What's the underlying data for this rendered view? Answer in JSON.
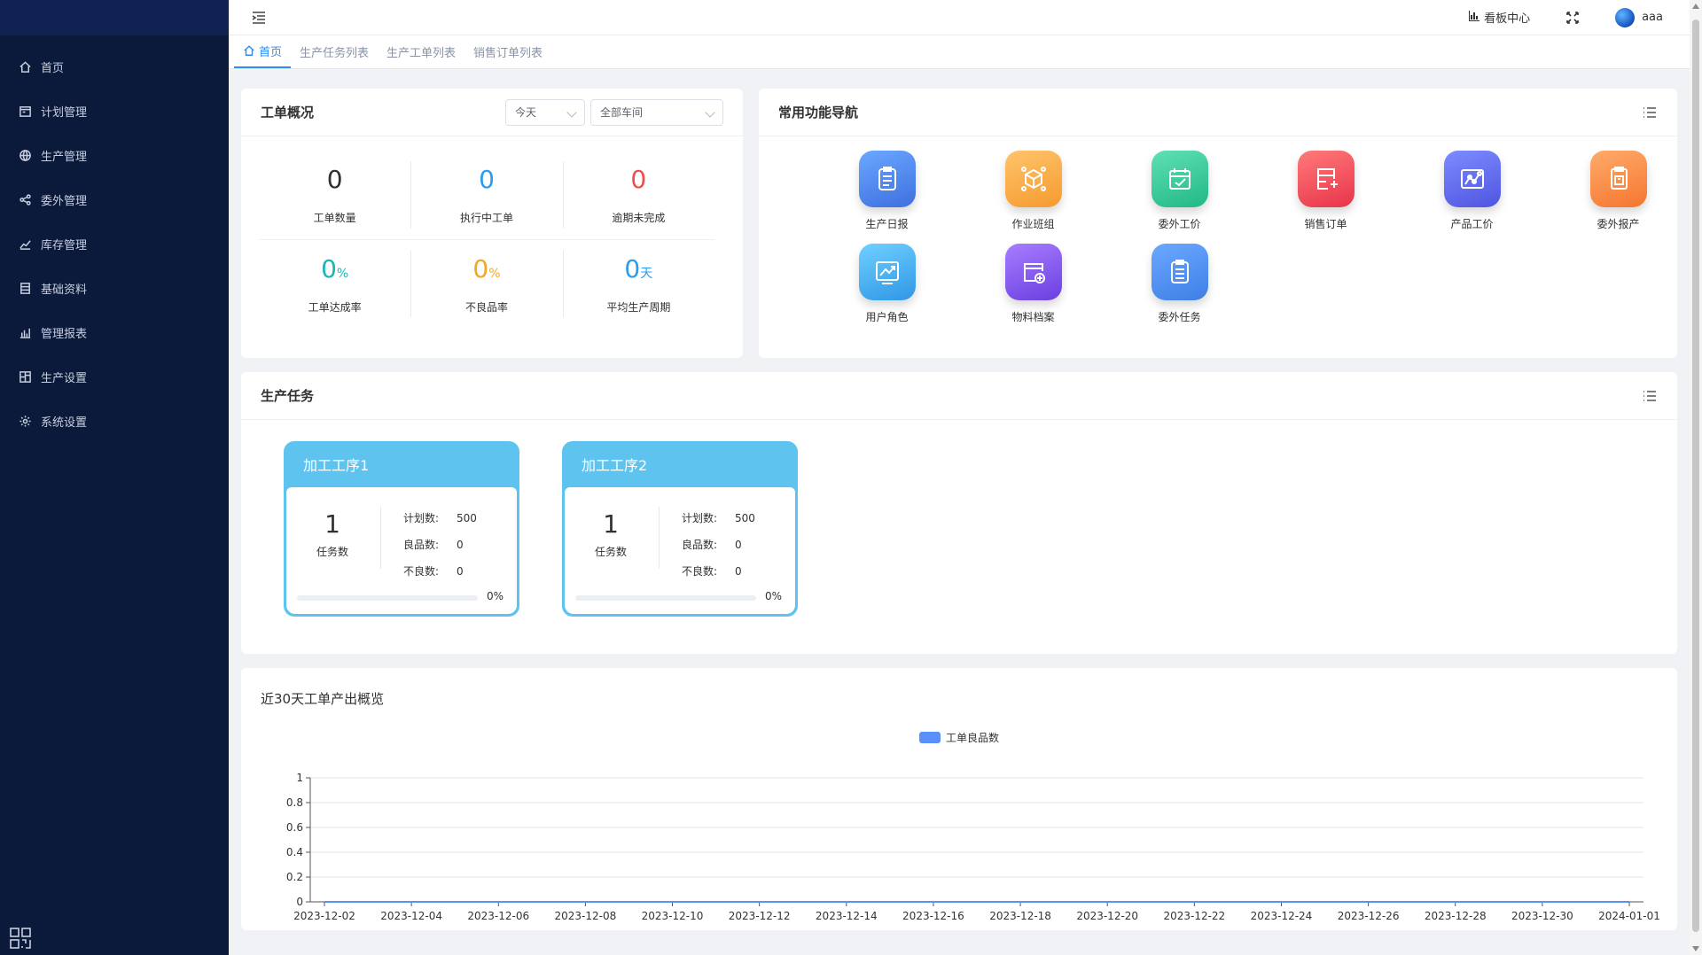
{
  "sidebar": {
    "items": [
      {
        "label": "首页",
        "icon": "home-icon"
      },
      {
        "label": "计划管理",
        "icon": "calendar-icon"
      },
      {
        "label": "生产管理",
        "icon": "globe-icon"
      },
      {
        "label": "委外管理",
        "icon": "share-icon"
      },
      {
        "label": "库存管理",
        "icon": "trend-icon"
      },
      {
        "label": "基础资料",
        "icon": "document-icon"
      },
      {
        "label": "管理报表",
        "icon": "bar-chart-icon"
      },
      {
        "label": "生产设置",
        "icon": "grid-icon"
      },
      {
        "label": "系统设置",
        "icon": "gear-icon"
      }
    ]
  },
  "topbar": {
    "kanban_label": "看板中心",
    "username": "aaa"
  },
  "tabs": [
    {
      "label": "首页",
      "active": true
    },
    {
      "label": "生产任务列表",
      "active": false
    },
    {
      "label": "生产工单列表",
      "active": false
    },
    {
      "label": "销售订单列表",
      "active": false
    }
  ],
  "overview": {
    "title": "工单概况",
    "date_select": "今天",
    "workshop_select": "全部车间",
    "stats": [
      {
        "value": "0",
        "unit": "",
        "label": "工单数量",
        "color": "#303133"
      },
      {
        "value": "0",
        "unit": "",
        "label": "执行中工单",
        "color": "#2d9cf0"
      },
      {
        "value": "0",
        "unit": "",
        "label": "逾期未完成",
        "color": "#f04e4e"
      },
      {
        "value": "0",
        "unit": "%",
        "label": "工单达成率",
        "color": "#1bb5b5"
      },
      {
        "value": "0",
        "unit": "%",
        "label": "不良品率",
        "color": "#f5a623"
      },
      {
        "value": "0",
        "unit": "天",
        "label": "平均生产周期",
        "color": "#2d9cf0"
      }
    ]
  },
  "nav": {
    "title": "常用功能导航",
    "items": [
      {
        "label": "生产日报",
        "icon": "clipboard-icon",
        "color1": "#6aa8ff",
        "color2": "#3f6fe0"
      },
      {
        "label": "作业班组",
        "icon": "cube-network-icon",
        "color1": "#ffc46b",
        "color2": "#f59a2f"
      },
      {
        "label": "委外工价",
        "icon": "calendar-check-icon",
        "color1": "#5fe0b4",
        "color2": "#22b886"
      },
      {
        "label": "销售订单",
        "icon": "order-add-icon",
        "color1": "#ff7a7a",
        "color2": "#e8344a"
      },
      {
        "label": "产品工价",
        "icon": "chart-map-icon",
        "color1": "#7d8cff",
        "color2": "#4f55e0"
      },
      {
        "label": "委外报产",
        "icon": "report-copy-icon",
        "color1": "#ffab6b",
        "color2": "#f5762f"
      },
      {
        "label": "用户角色",
        "icon": "line-chart-icon",
        "color1": "#6fd0ff",
        "color2": "#2f97e6"
      },
      {
        "label": "物料档案",
        "icon": "folder-add-icon",
        "color1": "#a87dff",
        "color2": "#6a3fe0"
      },
      {
        "label": "委外任务",
        "icon": "list-doc-icon",
        "color1": "#6aa8ff",
        "color2": "#3f7fe6"
      }
    ]
  },
  "tasks": {
    "title": "生产任务",
    "items": [
      {
        "name": "加工工序1",
        "count": "1",
        "count_label": "任务数",
        "plan_label": "计划数:",
        "plan": "500",
        "good_label": "良品数:",
        "good": "0",
        "bad_label": "不良数:",
        "bad": "0",
        "progress": 0,
        "progress_text": "0%"
      },
      {
        "name": "加工工序2",
        "count": "1",
        "count_label": "任务数",
        "plan_label": "计划数:",
        "plan": "500",
        "good_label": "良品数:",
        "good": "0",
        "bad_label": "不良数:",
        "bad": "0",
        "progress": 0,
        "progress_text": "0%"
      }
    ]
  },
  "chart_data": {
    "type": "line",
    "title": "近30天工单产出概览",
    "series": [
      {
        "name": "工单良品数",
        "color": "#5b8ff9",
        "values": [
          0,
          0,
          0,
          0,
          0,
          0,
          0,
          0,
          0,
          0,
          0,
          0,
          0,
          0,
          0,
          0
        ]
      }
    ],
    "x": [
      "2023-12-02",
      "2023-12-04",
      "2023-12-06",
      "2023-12-08",
      "2023-12-10",
      "2023-12-12",
      "2023-12-14",
      "2023-12-16",
      "2023-12-18",
      "2023-12-20",
      "2023-12-22",
      "2023-12-24",
      "2023-12-26",
      "2023-12-28",
      "2023-12-30",
      "2024-01-01"
    ],
    "yticks": [
      0,
      0.2,
      0.4,
      0.6,
      0.8,
      1
    ],
    "ylim": [
      0,
      1
    ],
    "legend": "top-center",
    "grid": true
  }
}
